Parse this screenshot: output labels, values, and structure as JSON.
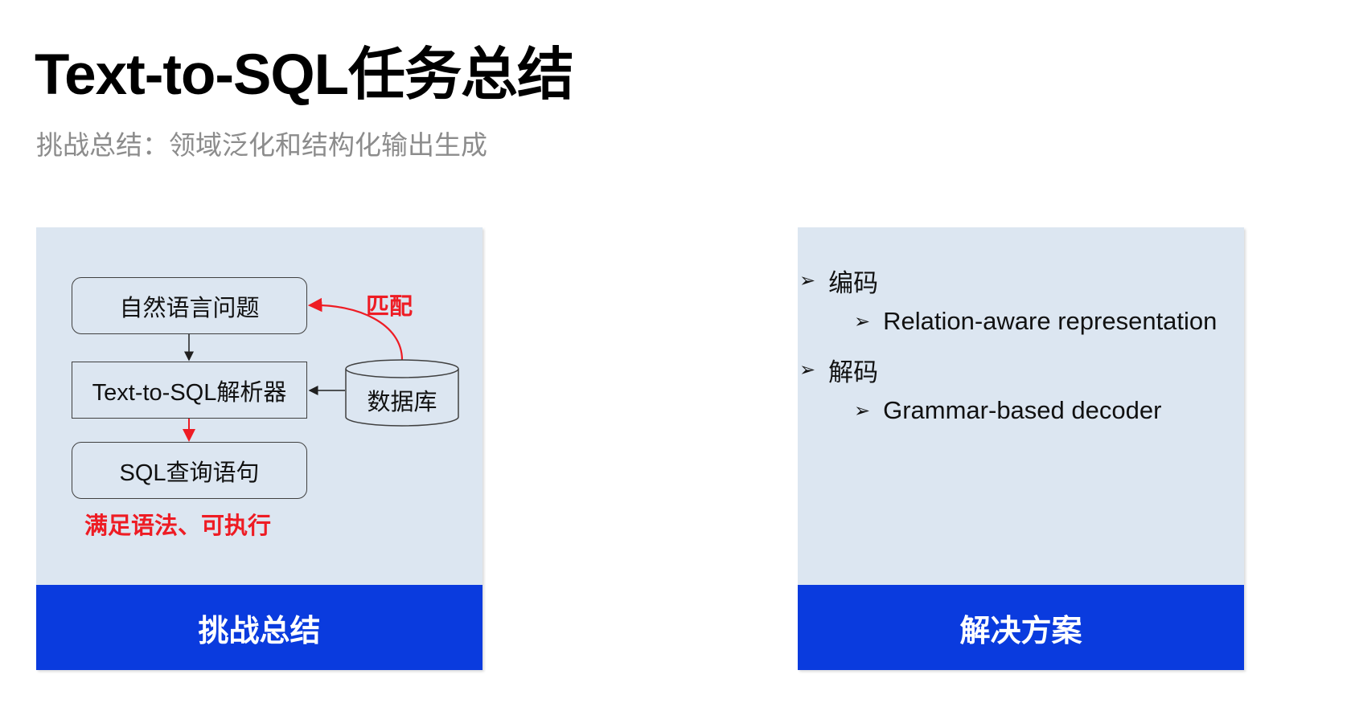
{
  "slide": {
    "title": "Text-to-SQL任务总结",
    "subtitle": "挑战总结：领域泛化和结构化输出生成"
  },
  "left_panel": {
    "footer_label": "挑战总结",
    "diagram": {
      "question_node": "自然语言问题",
      "parser_node": "Text-to-SQL解析器",
      "sql_node": "SQL查询语句",
      "database_node": "数据库",
      "match_label": "匹配",
      "constraint_label": "满足语法、可执行",
      "red_color": "#ee1c24"
    }
  },
  "right_panel": {
    "footer_label": "解决方案",
    "bullet_marker": "➢",
    "items": [
      {
        "level": 1,
        "text": "编码"
      },
      {
        "level": 2,
        "text": "Relation-aware representation"
      },
      {
        "level": 1,
        "text": "解码"
      },
      {
        "level": 2,
        "text": "Grammar-based decoder"
      }
    ]
  },
  "colors": {
    "panel_bg": "#dce6f1",
    "footer_bg": "#0a3bde",
    "subtitle": "#8c8c8c"
  }
}
